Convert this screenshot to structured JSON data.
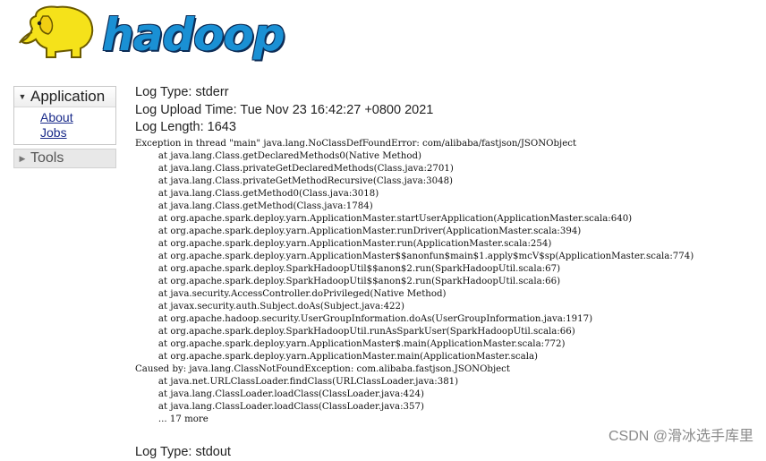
{
  "header": {
    "logo_text": "hadoop",
    "logo_icon": "elephant-icon"
  },
  "sidebar": {
    "application_label": "Application",
    "links": [
      "About",
      "Jobs"
    ],
    "tools_label": "Tools",
    "expanded_icon": "caret-down-icon",
    "collapsed_icon": "caret-right-icon"
  },
  "log": {
    "type_line": "Log Type: stderr",
    "upload_line": "Log Upload Time: Tue Nov 23 16:42:27 +0800 2021",
    "length_line": "Log Length: 1643",
    "body": "Exception in thread \"main\" java.lang.NoClassDefFoundError: com/alibaba/fastjson/JSONObject\n\tat java.lang.Class.getDeclaredMethods0(Native Method)\n\tat java.lang.Class.privateGetDeclaredMethods(Class.java:2701)\n\tat java.lang.Class.privateGetMethodRecursive(Class.java:3048)\n\tat java.lang.Class.getMethod0(Class.java:3018)\n\tat java.lang.Class.getMethod(Class.java:1784)\n\tat org.apache.spark.deploy.yarn.ApplicationMaster.startUserApplication(ApplicationMaster.scala:640)\n\tat org.apache.spark.deploy.yarn.ApplicationMaster.runDriver(ApplicationMaster.scala:394)\n\tat org.apache.spark.deploy.yarn.ApplicationMaster.run(ApplicationMaster.scala:254)\n\tat org.apache.spark.deploy.yarn.ApplicationMaster$$anonfun$main$1.apply$mcV$sp(ApplicationMaster.scala:774)\n\tat org.apache.spark.deploy.SparkHadoopUtil$$anon$2.run(SparkHadoopUtil.scala:67)\n\tat org.apache.spark.deploy.SparkHadoopUtil$$anon$2.run(SparkHadoopUtil.scala:66)\n\tat java.security.AccessController.doPrivileged(Native Method)\n\tat javax.security.auth.Subject.doAs(Subject.java:422)\n\tat org.apache.hadoop.security.UserGroupInformation.doAs(UserGroupInformation.java:1917)\n\tat org.apache.spark.deploy.SparkHadoopUtil.runAsSparkUser(SparkHadoopUtil.scala:66)\n\tat org.apache.spark.deploy.yarn.ApplicationMaster$.main(ApplicationMaster.scala:772)\n\tat org.apache.spark.deploy.yarn.ApplicationMaster.main(ApplicationMaster.scala)\nCaused by: java.lang.ClassNotFoundException: com.alibaba.fastjson.JSONObject\n\tat java.net.URLClassLoader.findClass(URLClassLoader.java:381)\n\tat java.lang.ClassLoader.loadClass(ClassLoader.java:424)\n\tat java.lang.ClassLoader.loadClass(ClassLoader.java:357)\n\t... 17 more",
    "next_type_line": "Log Type: stdout"
  },
  "watermark": "CSDN @滑冰选手库里"
}
